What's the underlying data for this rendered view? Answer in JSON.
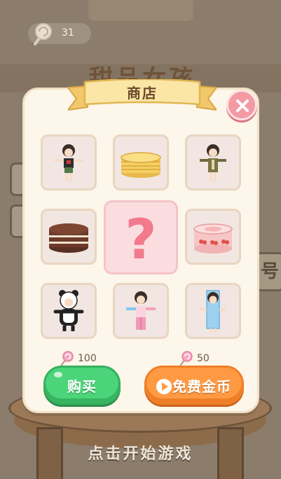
{
  "hud": {
    "coin_count": "31"
  },
  "background": {
    "game_title": "甜品女孩",
    "start_prompt": "点击开始游戏",
    "side_glyph": "号"
  },
  "shop": {
    "title": "商店",
    "items": [
      {
        "name": "girl-outfit-black-red"
      },
      {
        "name": "pancake-stack"
      },
      {
        "name": "girl-outfit-olive"
      },
      {
        "name": "chocolate-cake"
      },
      {
        "name": "mystery-item",
        "selected": true,
        "symbol": "?"
      },
      {
        "name": "cherry-roll-cake"
      },
      {
        "name": "girl-outfit-panda"
      },
      {
        "name": "girl-outfit-rainbow"
      },
      {
        "name": "girl-outfit-blue-box"
      }
    ],
    "buy_price": "100",
    "free_price": "50",
    "buy_label": "购买",
    "free_label": "免费金币"
  },
  "colors": {
    "modal_bg": "#fdf6ea",
    "buy_green": "#4cd47a",
    "free_orange": "#ff9a43",
    "close_pink": "#f39aa3",
    "question_pink": "#f17a8c"
  }
}
